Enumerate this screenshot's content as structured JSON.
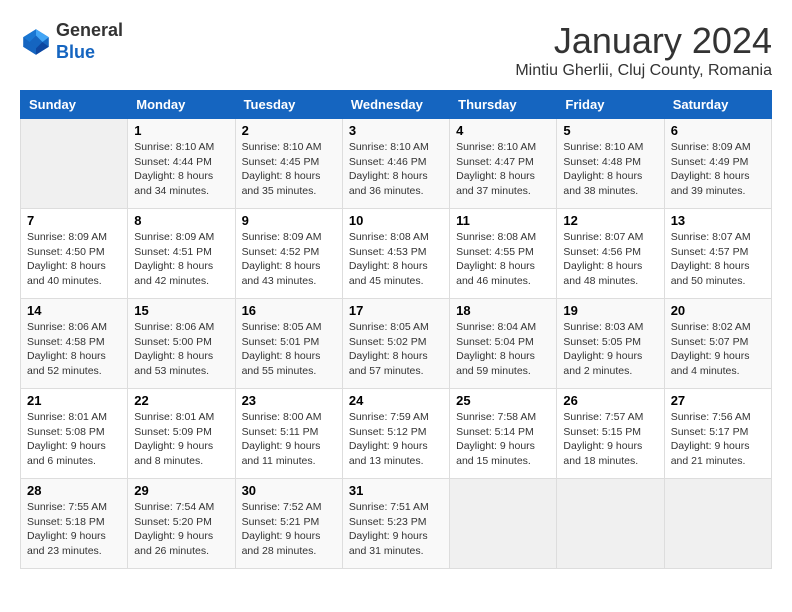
{
  "logo": {
    "general": "General",
    "blue": "Blue"
  },
  "title": "January 2024",
  "subtitle": "Mintiu Gherlii, Cluj County, Romania",
  "days_of_week": [
    "Sunday",
    "Monday",
    "Tuesday",
    "Wednesday",
    "Thursday",
    "Friday",
    "Saturday"
  ],
  "weeks": [
    [
      {
        "day": "",
        "info": ""
      },
      {
        "day": "1",
        "info": "Sunrise: 8:10 AM\nSunset: 4:44 PM\nDaylight: 8 hours\nand 34 minutes."
      },
      {
        "day": "2",
        "info": "Sunrise: 8:10 AM\nSunset: 4:45 PM\nDaylight: 8 hours\nand 35 minutes."
      },
      {
        "day": "3",
        "info": "Sunrise: 8:10 AM\nSunset: 4:46 PM\nDaylight: 8 hours\nand 36 minutes."
      },
      {
        "day": "4",
        "info": "Sunrise: 8:10 AM\nSunset: 4:47 PM\nDaylight: 8 hours\nand 37 minutes."
      },
      {
        "day": "5",
        "info": "Sunrise: 8:10 AM\nSunset: 4:48 PM\nDaylight: 8 hours\nand 38 minutes."
      },
      {
        "day": "6",
        "info": "Sunrise: 8:09 AM\nSunset: 4:49 PM\nDaylight: 8 hours\nand 39 minutes."
      }
    ],
    [
      {
        "day": "7",
        "info": "Sunrise: 8:09 AM\nSunset: 4:50 PM\nDaylight: 8 hours\nand 40 minutes."
      },
      {
        "day": "8",
        "info": "Sunrise: 8:09 AM\nSunset: 4:51 PM\nDaylight: 8 hours\nand 42 minutes."
      },
      {
        "day": "9",
        "info": "Sunrise: 8:09 AM\nSunset: 4:52 PM\nDaylight: 8 hours\nand 43 minutes."
      },
      {
        "day": "10",
        "info": "Sunrise: 8:08 AM\nSunset: 4:53 PM\nDaylight: 8 hours\nand 45 minutes."
      },
      {
        "day": "11",
        "info": "Sunrise: 8:08 AM\nSunset: 4:55 PM\nDaylight: 8 hours\nand 46 minutes."
      },
      {
        "day": "12",
        "info": "Sunrise: 8:07 AM\nSunset: 4:56 PM\nDaylight: 8 hours\nand 48 minutes."
      },
      {
        "day": "13",
        "info": "Sunrise: 8:07 AM\nSunset: 4:57 PM\nDaylight: 8 hours\nand 50 minutes."
      }
    ],
    [
      {
        "day": "14",
        "info": "Sunrise: 8:06 AM\nSunset: 4:58 PM\nDaylight: 8 hours\nand 52 minutes."
      },
      {
        "day": "15",
        "info": "Sunrise: 8:06 AM\nSunset: 5:00 PM\nDaylight: 8 hours\nand 53 minutes."
      },
      {
        "day": "16",
        "info": "Sunrise: 8:05 AM\nSunset: 5:01 PM\nDaylight: 8 hours\nand 55 minutes."
      },
      {
        "day": "17",
        "info": "Sunrise: 8:05 AM\nSunset: 5:02 PM\nDaylight: 8 hours\nand 57 minutes."
      },
      {
        "day": "18",
        "info": "Sunrise: 8:04 AM\nSunset: 5:04 PM\nDaylight: 8 hours\nand 59 minutes."
      },
      {
        "day": "19",
        "info": "Sunrise: 8:03 AM\nSunset: 5:05 PM\nDaylight: 9 hours\nand 2 minutes."
      },
      {
        "day": "20",
        "info": "Sunrise: 8:02 AM\nSunset: 5:07 PM\nDaylight: 9 hours\nand 4 minutes."
      }
    ],
    [
      {
        "day": "21",
        "info": "Sunrise: 8:01 AM\nSunset: 5:08 PM\nDaylight: 9 hours\nand 6 minutes."
      },
      {
        "day": "22",
        "info": "Sunrise: 8:01 AM\nSunset: 5:09 PM\nDaylight: 9 hours\nand 8 minutes."
      },
      {
        "day": "23",
        "info": "Sunrise: 8:00 AM\nSunset: 5:11 PM\nDaylight: 9 hours\nand 11 minutes."
      },
      {
        "day": "24",
        "info": "Sunrise: 7:59 AM\nSunset: 5:12 PM\nDaylight: 9 hours\nand 13 minutes."
      },
      {
        "day": "25",
        "info": "Sunrise: 7:58 AM\nSunset: 5:14 PM\nDaylight: 9 hours\nand 15 minutes."
      },
      {
        "day": "26",
        "info": "Sunrise: 7:57 AM\nSunset: 5:15 PM\nDaylight: 9 hours\nand 18 minutes."
      },
      {
        "day": "27",
        "info": "Sunrise: 7:56 AM\nSunset: 5:17 PM\nDaylight: 9 hours\nand 21 minutes."
      }
    ],
    [
      {
        "day": "28",
        "info": "Sunrise: 7:55 AM\nSunset: 5:18 PM\nDaylight: 9 hours\nand 23 minutes."
      },
      {
        "day": "29",
        "info": "Sunrise: 7:54 AM\nSunset: 5:20 PM\nDaylight: 9 hours\nand 26 minutes."
      },
      {
        "day": "30",
        "info": "Sunrise: 7:52 AM\nSunset: 5:21 PM\nDaylight: 9 hours\nand 28 minutes."
      },
      {
        "day": "31",
        "info": "Sunrise: 7:51 AM\nSunset: 5:23 PM\nDaylight: 9 hours\nand 31 minutes."
      },
      {
        "day": "",
        "info": ""
      },
      {
        "day": "",
        "info": ""
      },
      {
        "day": "",
        "info": ""
      }
    ]
  ]
}
